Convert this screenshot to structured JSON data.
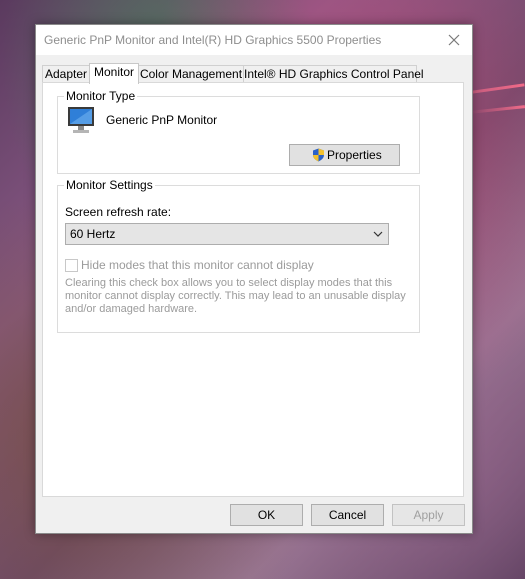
{
  "window": {
    "title": "Generic PnP Monitor and Intel(R) HD Graphics 5500 Properties"
  },
  "tabs": [
    {
      "label": "Adapter",
      "active": false
    },
    {
      "label": "Monitor",
      "active": true
    },
    {
      "label": "Color Management",
      "active": false
    },
    {
      "label": "Intel® HD Graphics Control Panel",
      "active": false
    }
  ],
  "monitor_type": {
    "legend": "Monitor Type",
    "name": "Generic PnP Monitor",
    "properties_button": "Properties"
  },
  "monitor_settings": {
    "legend": "Monitor Settings",
    "refresh_label": "Screen refresh rate:",
    "refresh_value": "60 Hertz",
    "hide_modes_label": "Hide modes that this monitor cannot display",
    "hide_modes_checked": false,
    "help_text": "Clearing this check box allows you to select display modes that this monitor cannot display correctly. This may lead to an unusable display and/or damaged hardware."
  },
  "buttons": {
    "ok": "OK",
    "cancel": "Cancel",
    "apply": "Apply"
  },
  "colors": {
    "dialog_bg": "#f0f0f0",
    "panel_bg": "#ffffff",
    "disabled_text": "#9b9b9b",
    "shield_blue": "#2a62c9",
    "shield_yellow": "#f2c12e"
  }
}
